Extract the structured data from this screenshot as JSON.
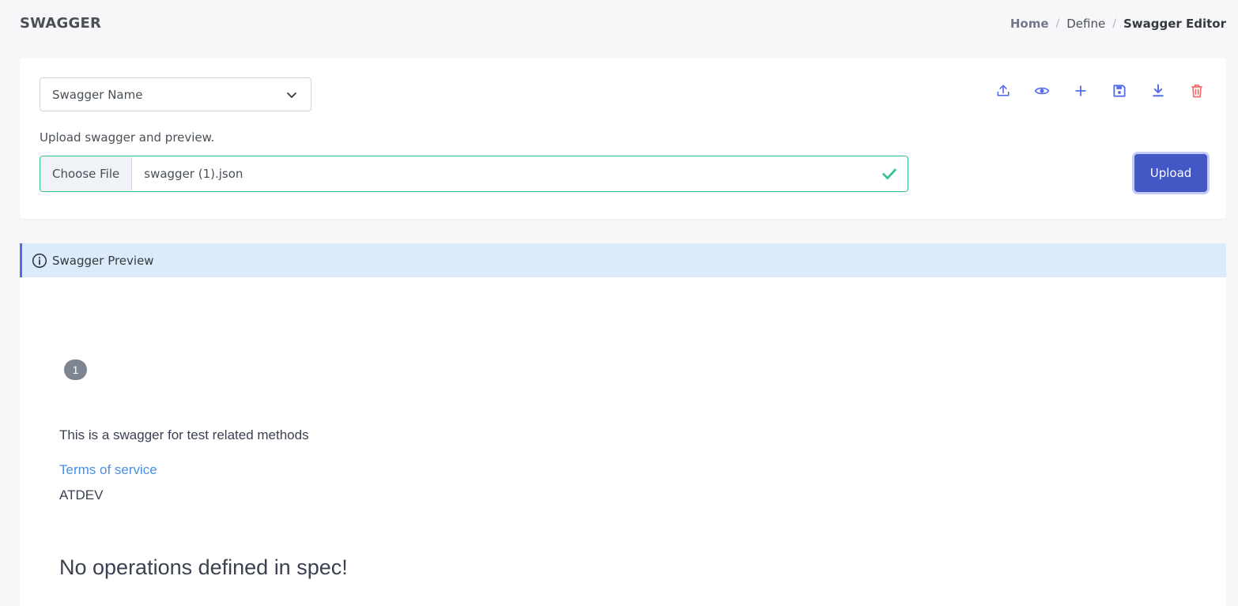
{
  "header": {
    "title": "SWAGGER",
    "breadcrumb": {
      "home": "Home",
      "define": "Define",
      "current": "Swagger Editor",
      "separator": "/"
    }
  },
  "form": {
    "select_value": "Swagger Name",
    "upload_label": "Upload swagger and preview.",
    "file_button": "Choose File",
    "file_name": "swagger (1).json",
    "upload_button": "Upload"
  },
  "toolbar": {
    "icons": [
      "upload-icon",
      "eye-icon",
      "plus-icon",
      "save-icon",
      "download-icon",
      "trash-icon"
    ]
  },
  "preview": {
    "alert_title": "Swagger Preview",
    "version": "1",
    "description": "This is a swagger for test related methods",
    "terms_link": "Terms of service",
    "contact": "ATDEV",
    "no_operations": "No operations defined in spec!"
  },
  "colors": {
    "primary": "#4458c5",
    "icon_blue": "#556ee6",
    "danger": "#f46a6a",
    "success": "#34c38f",
    "alert_bg": "#dcebfa",
    "link": "#4990e2"
  }
}
